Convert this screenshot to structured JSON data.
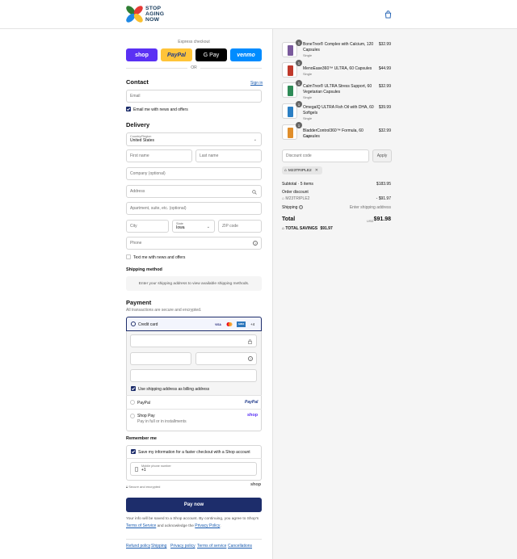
{
  "header": {
    "brand_line1": "STOP",
    "brand_line2": "AGING",
    "brand_line3": "NOW",
    "cart_icon": "shopping-bag-icon"
  },
  "express": {
    "label": "Express checkout",
    "buttons": [
      "shop",
      "PayPal",
      "G Pay",
      "venmo"
    ],
    "or": "OR"
  },
  "contact": {
    "heading": "Contact",
    "sign_in": "Sign in",
    "email_placeholder": "Email",
    "email_news": "Email me with news and offers"
  },
  "delivery": {
    "heading": "Delivery",
    "country_label": "Country/Region",
    "country_value": "United States",
    "first_name": "First name",
    "last_name": "Last name",
    "company": "Company (optional)",
    "address": "Address",
    "apartment": "Apartment, suite, etc. (optional)",
    "city": "City",
    "state_label": "State",
    "state_value": "Iowa",
    "zip": "ZIP code",
    "phone": "Phone",
    "text_news": "Text me with news and offers"
  },
  "shipping": {
    "heading": "Shipping method",
    "message": "Enter your shipping address to view available shipping methods."
  },
  "payment": {
    "heading": "Payment",
    "subtitle": "All transactions are secure and encrypted.",
    "credit_card": "Credit card",
    "card_brands": [
      "VISA",
      "MC",
      "AMEX"
    ],
    "more_cards": "+4",
    "billing_same": "Use shipping address as billing address",
    "paypal": "PayPal",
    "paypal_logo": "PayPal",
    "shop_pay": "Shop Pay",
    "shop_pay_sub": "Pay in full or in installments",
    "shop_logo": "shop"
  },
  "remember": {
    "heading": "Remember me",
    "save_info": "Save my information for a faster checkout with a Shop account",
    "mobile_label": "Mobile phone number",
    "mobile_value": "+1",
    "secure": "Secure and encrypted",
    "shop_logo": "shop"
  },
  "pay_now": "Pay now",
  "disclaimer": {
    "line1": "Your info will be saved to a Shop account. By continuing, you agree to Shop's",
    "terms": "Terms of Service",
    "and": "and acknowledge the",
    "privacy": "Privacy Policy",
    "end": "."
  },
  "footer_links": [
    "Refund policy",
    "Shipping",
    "Privacy policy",
    "Terms of service",
    "Cancellations"
  ],
  "cart": {
    "items": [
      {
        "qty": "1",
        "name": "BoneTrex® Complex with Calcium, 120 Capsules",
        "variant": "Single",
        "price": "$32.99",
        "color": "#7a5a9c"
      },
      {
        "qty": "1",
        "name": "MenoEase360™ ULTRA, 60 Capsules",
        "variant": "Single",
        "price": "$44.99",
        "color": "#c0392b"
      },
      {
        "qty": "1",
        "name": "CalmTrex® ULTRA Stress Support, 60 Vegetarian Capsules",
        "variant": "Single",
        "price": "$32.99",
        "color": "#2e8b57"
      },
      {
        "qty": "1",
        "name": "OmegaIQ ULTRA Fish Oil with DHA, 60 Softgels",
        "variant": "Single",
        "price": "$39.99",
        "color": "#2b7fc4"
      },
      {
        "qty": "1",
        "name": "BladderControl360™ Formula, 60 Capsules",
        "variant": "Single",
        "price": "$32.99",
        "color": "#e08e2b"
      }
    ],
    "discount_placeholder": "Discount code",
    "apply": "Apply",
    "applied_code": "M23TRIPLE2",
    "subtotal_label": "Subtotal · 5 items",
    "subtotal_value": "$183.95",
    "order_discount": "Order discount",
    "discount_code": "M23TRIPLE2",
    "discount_value": "- $91.97",
    "shipping_label": "Shipping",
    "shipping_value": "Enter shipping address",
    "total_label": "Total",
    "currency": "USD",
    "total_value": "$91.98",
    "savings_label": "TOTAL SAVINGS",
    "savings_value": "$91.97"
  }
}
